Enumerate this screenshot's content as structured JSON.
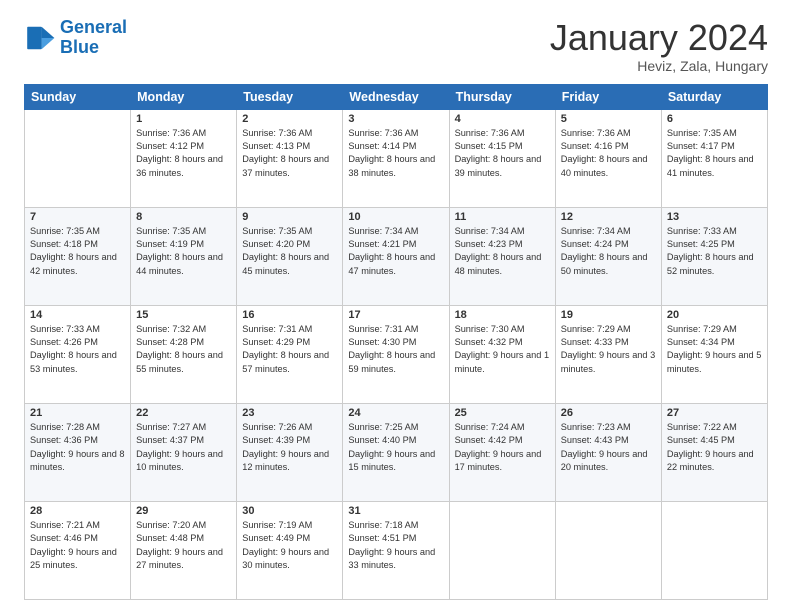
{
  "header": {
    "logo_line1": "General",
    "logo_line2": "Blue",
    "month": "January 2024",
    "location": "Heviz, Zala, Hungary"
  },
  "days_of_week": [
    "Sunday",
    "Monday",
    "Tuesday",
    "Wednesday",
    "Thursday",
    "Friday",
    "Saturday"
  ],
  "weeks": [
    [
      {
        "day": "",
        "sunrise": "",
        "sunset": "",
        "daylight": ""
      },
      {
        "day": "1",
        "sunrise": "Sunrise: 7:36 AM",
        "sunset": "Sunset: 4:12 PM",
        "daylight": "Daylight: 8 hours and 36 minutes."
      },
      {
        "day": "2",
        "sunrise": "Sunrise: 7:36 AM",
        "sunset": "Sunset: 4:13 PM",
        "daylight": "Daylight: 8 hours and 37 minutes."
      },
      {
        "day": "3",
        "sunrise": "Sunrise: 7:36 AM",
        "sunset": "Sunset: 4:14 PM",
        "daylight": "Daylight: 8 hours and 38 minutes."
      },
      {
        "day": "4",
        "sunrise": "Sunrise: 7:36 AM",
        "sunset": "Sunset: 4:15 PM",
        "daylight": "Daylight: 8 hours and 39 minutes."
      },
      {
        "day": "5",
        "sunrise": "Sunrise: 7:36 AM",
        "sunset": "Sunset: 4:16 PM",
        "daylight": "Daylight: 8 hours and 40 minutes."
      },
      {
        "day": "6",
        "sunrise": "Sunrise: 7:35 AM",
        "sunset": "Sunset: 4:17 PM",
        "daylight": "Daylight: 8 hours and 41 minutes."
      }
    ],
    [
      {
        "day": "7",
        "sunrise": "Sunrise: 7:35 AM",
        "sunset": "Sunset: 4:18 PM",
        "daylight": "Daylight: 8 hours and 42 minutes."
      },
      {
        "day": "8",
        "sunrise": "Sunrise: 7:35 AM",
        "sunset": "Sunset: 4:19 PM",
        "daylight": "Daylight: 8 hours and 44 minutes."
      },
      {
        "day": "9",
        "sunrise": "Sunrise: 7:35 AM",
        "sunset": "Sunset: 4:20 PM",
        "daylight": "Daylight: 8 hours and 45 minutes."
      },
      {
        "day": "10",
        "sunrise": "Sunrise: 7:34 AM",
        "sunset": "Sunset: 4:21 PM",
        "daylight": "Daylight: 8 hours and 47 minutes."
      },
      {
        "day": "11",
        "sunrise": "Sunrise: 7:34 AM",
        "sunset": "Sunset: 4:23 PM",
        "daylight": "Daylight: 8 hours and 48 minutes."
      },
      {
        "day": "12",
        "sunrise": "Sunrise: 7:34 AM",
        "sunset": "Sunset: 4:24 PM",
        "daylight": "Daylight: 8 hours and 50 minutes."
      },
      {
        "day": "13",
        "sunrise": "Sunrise: 7:33 AM",
        "sunset": "Sunset: 4:25 PM",
        "daylight": "Daylight: 8 hours and 52 minutes."
      }
    ],
    [
      {
        "day": "14",
        "sunrise": "Sunrise: 7:33 AM",
        "sunset": "Sunset: 4:26 PM",
        "daylight": "Daylight: 8 hours and 53 minutes."
      },
      {
        "day": "15",
        "sunrise": "Sunrise: 7:32 AM",
        "sunset": "Sunset: 4:28 PM",
        "daylight": "Daylight: 8 hours and 55 minutes."
      },
      {
        "day": "16",
        "sunrise": "Sunrise: 7:31 AM",
        "sunset": "Sunset: 4:29 PM",
        "daylight": "Daylight: 8 hours and 57 minutes."
      },
      {
        "day": "17",
        "sunrise": "Sunrise: 7:31 AM",
        "sunset": "Sunset: 4:30 PM",
        "daylight": "Daylight: 8 hours and 59 minutes."
      },
      {
        "day": "18",
        "sunrise": "Sunrise: 7:30 AM",
        "sunset": "Sunset: 4:32 PM",
        "daylight": "Daylight: 9 hours and 1 minute."
      },
      {
        "day": "19",
        "sunrise": "Sunrise: 7:29 AM",
        "sunset": "Sunset: 4:33 PM",
        "daylight": "Daylight: 9 hours and 3 minutes."
      },
      {
        "day": "20",
        "sunrise": "Sunrise: 7:29 AM",
        "sunset": "Sunset: 4:34 PM",
        "daylight": "Daylight: 9 hours and 5 minutes."
      }
    ],
    [
      {
        "day": "21",
        "sunrise": "Sunrise: 7:28 AM",
        "sunset": "Sunset: 4:36 PM",
        "daylight": "Daylight: 9 hours and 8 minutes."
      },
      {
        "day": "22",
        "sunrise": "Sunrise: 7:27 AM",
        "sunset": "Sunset: 4:37 PM",
        "daylight": "Daylight: 9 hours and 10 minutes."
      },
      {
        "day": "23",
        "sunrise": "Sunrise: 7:26 AM",
        "sunset": "Sunset: 4:39 PM",
        "daylight": "Daylight: 9 hours and 12 minutes."
      },
      {
        "day": "24",
        "sunrise": "Sunrise: 7:25 AM",
        "sunset": "Sunset: 4:40 PM",
        "daylight": "Daylight: 9 hours and 15 minutes."
      },
      {
        "day": "25",
        "sunrise": "Sunrise: 7:24 AM",
        "sunset": "Sunset: 4:42 PM",
        "daylight": "Daylight: 9 hours and 17 minutes."
      },
      {
        "day": "26",
        "sunrise": "Sunrise: 7:23 AM",
        "sunset": "Sunset: 4:43 PM",
        "daylight": "Daylight: 9 hours and 20 minutes."
      },
      {
        "day": "27",
        "sunrise": "Sunrise: 7:22 AM",
        "sunset": "Sunset: 4:45 PM",
        "daylight": "Daylight: 9 hours and 22 minutes."
      }
    ],
    [
      {
        "day": "28",
        "sunrise": "Sunrise: 7:21 AM",
        "sunset": "Sunset: 4:46 PM",
        "daylight": "Daylight: 9 hours and 25 minutes."
      },
      {
        "day": "29",
        "sunrise": "Sunrise: 7:20 AM",
        "sunset": "Sunset: 4:48 PM",
        "daylight": "Daylight: 9 hours and 27 minutes."
      },
      {
        "day": "30",
        "sunrise": "Sunrise: 7:19 AM",
        "sunset": "Sunset: 4:49 PM",
        "daylight": "Daylight: 9 hours and 30 minutes."
      },
      {
        "day": "31",
        "sunrise": "Sunrise: 7:18 AM",
        "sunset": "Sunset: 4:51 PM",
        "daylight": "Daylight: 9 hours and 33 minutes."
      },
      {
        "day": "",
        "sunrise": "",
        "sunset": "",
        "daylight": ""
      },
      {
        "day": "",
        "sunrise": "",
        "sunset": "",
        "daylight": ""
      },
      {
        "day": "",
        "sunrise": "",
        "sunset": "",
        "daylight": ""
      }
    ]
  ]
}
